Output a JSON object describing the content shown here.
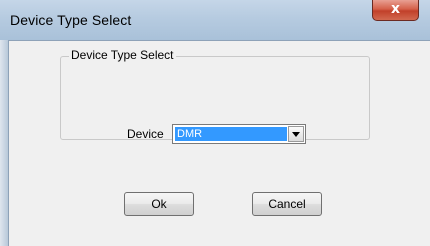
{
  "window": {
    "title": "Device Type Select",
    "close_glyph": "x"
  },
  "group": {
    "legend": "Device Type Select"
  },
  "device": {
    "label": "Device",
    "selected": "DMR"
  },
  "buttons": {
    "ok": "Ok",
    "cancel": "Cancel"
  },
  "icons": {
    "close": "close-icon",
    "dropdown": "chevron-down-icon"
  },
  "colors": {
    "titlebar": "#b6cbe0",
    "close_button": "#c94a35",
    "selection_highlight": "#3399ff",
    "client_background": "#f0f0f0"
  }
}
